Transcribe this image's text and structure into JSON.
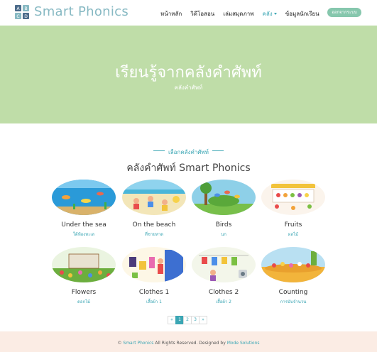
{
  "brand": {
    "name": "Smart Phonics",
    "icon_letters": [
      "A",
      "B",
      "C",
      "D"
    ]
  },
  "nav": {
    "items": [
      {
        "label": "หน้าหลัก"
      },
      {
        "label": "วิดีโอสอน"
      },
      {
        "label": "เล่มสมุดภาพ"
      },
      {
        "label": "คลัง"
      },
      {
        "label": "ข้อมูลนักเรียน"
      }
    ],
    "login": "ออกจากระบบ"
  },
  "hero": {
    "title": "เรียนรู้จากคลังคำศัพท์",
    "subtitle": "คลังคำศัพท์"
  },
  "section": {
    "label": "เลือกคลังคำศัพท์",
    "title": "คลังคำศัพท์ Smart Phonics"
  },
  "cards": [
    {
      "name": "Under the sea",
      "sub": "ใต้ท้องทะเล",
      "icon": "sea-scene-icon"
    },
    {
      "name": "On the beach",
      "sub": "ที่ชายหาด",
      "icon": "beach-scene-icon"
    },
    {
      "name": "Birds",
      "sub": "นก",
      "icon": "birds-scene-icon"
    },
    {
      "name": "Fruits",
      "sub": "ผลไม้",
      "icon": "fruits-scene-icon"
    },
    {
      "name": "Flowers",
      "sub": "ดอกไม้",
      "icon": "flowers-scene-icon"
    },
    {
      "name": "Clothes 1",
      "sub": "เสื้อผ้า 1",
      "icon": "clothes-scene-icon"
    },
    {
      "name": "Clothes 2",
      "sub": "เสื้อผ้า 2",
      "icon": "clothes-scene-icon"
    },
    {
      "name": "Counting",
      "sub": "การนับจำนวน",
      "icon": "counting-scene-icon"
    }
  ],
  "pagination": {
    "prev": "«",
    "pages": [
      "1",
      "2",
      "3"
    ],
    "next": "»",
    "current": "1"
  },
  "footer": {
    "copyright_symbol": "©",
    "brand": "Smart Phonics",
    "text": "All Rights Reserved. Designed by",
    "designer": "Mode Solutions"
  },
  "colors": {
    "accent": "#3ba6b4",
    "hero_bg": "#bfdda8",
    "footer_bg": "#fbece4",
    "login_bg": "#86c7ad",
    "logo_text": "#87b9c3"
  }
}
